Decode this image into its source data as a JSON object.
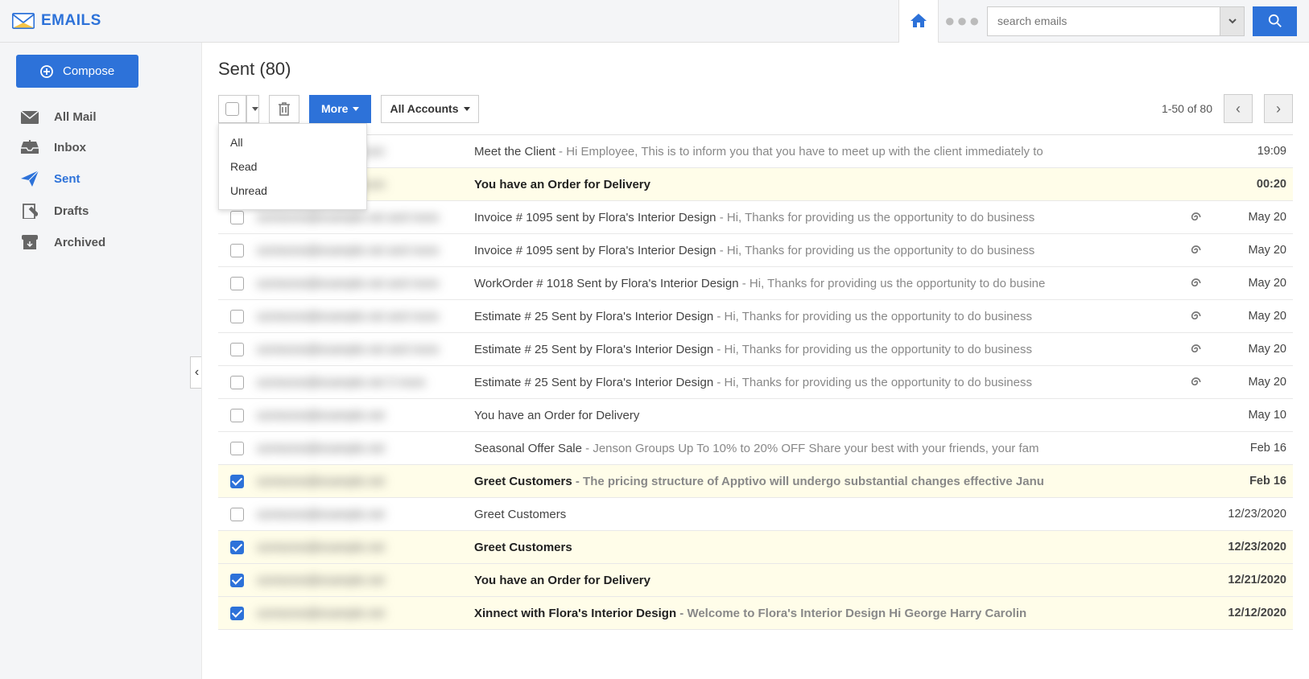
{
  "header": {
    "logo_text": "EMAILS",
    "search_placeholder": "search emails"
  },
  "sidebar": {
    "compose_label": "Compose",
    "items": [
      {
        "label": "All Mail"
      },
      {
        "label": "Inbox"
      },
      {
        "label": "Sent"
      },
      {
        "label": "Drafts"
      },
      {
        "label": "Archived"
      }
    ]
  },
  "main": {
    "title": "Sent (80)",
    "more_label": "More",
    "accounts_label": "All Accounts",
    "pager_label": "1-50 of 80",
    "dropdown": [
      "All",
      "Read",
      "Unread"
    ]
  },
  "emails": [
    {
      "checked": false,
      "unread": false,
      "sender": "noreply@outerijam.com",
      "subject": "Meet the Client",
      "preview": " - Hi Employee, This is to inform you that you have to meet up with the client immediately to",
      "attach": false,
      "date": "19:09"
    },
    {
      "checked": false,
      "unread": true,
      "sender": "support@outerijam.com",
      "subject": "You have an Order for Delivery",
      "preview": "",
      "attach": false,
      "date": "00:20"
    },
    {
      "checked": false,
      "unread": false,
      "sender": "someone@example.net and more",
      "subject": "Invoice # 1095 sent by Flora's Interior Design",
      "preview": " - Hi,  Thanks for providing us the opportunity to do business",
      "attach": true,
      "date": "May 20"
    },
    {
      "checked": false,
      "unread": false,
      "sender": "someone@example.net and more",
      "subject": "Invoice # 1095 sent by Flora's Interior Design",
      "preview": " - Hi,  Thanks for providing us the opportunity to do business",
      "attach": true,
      "date": "May 20"
    },
    {
      "checked": false,
      "unread": false,
      "sender": "someone@example.net and more",
      "subject": "WorkOrder # 1018 Sent by Flora's Interior Design",
      "preview": " - Hi, Thanks for providing us the opportunity to do busine",
      "attach": true,
      "date": "May 20"
    },
    {
      "checked": false,
      "unread": false,
      "sender": "someone@example.net and more",
      "subject": "Estimate # 25 Sent by Flora's Interior Design",
      "preview": " - Hi,  Thanks for providing us the opportunity to do business ",
      "attach": true,
      "date": "May 20"
    },
    {
      "checked": false,
      "unread": false,
      "sender": "someone@example.net and more",
      "subject": "Estimate # 25 Sent by Flora's Interior Design",
      "preview": " - Hi,  Thanks for providing us the opportunity to do business ",
      "attach": true,
      "date": "May 20"
    },
    {
      "checked": false,
      "unread": false,
      "sender": "someone@example.net 3 more",
      "subject": "Estimate # 25 Sent by Flora's Interior Design",
      "preview": " - Hi,  Thanks for providing us the opportunity to do business ",
      "attach": true,
      "date": "May 20"
    },
    {
      "checked": false,
      "unread": false,
      "sender": "someone@example.net",
      "subject": "You have an Order for Delivery",
      "preview": "",
      "attach": false,
      "date": "May 10"
    },
    {
      "checked": false,
      "unread": false,
      "sender": "someone@example.net",
      "subject": "Seasonal Offer Sale",
      "preview": " - Jenson Groups Up To 10% to 20% OFF Share your best with your friends, your fam",
      "attach": false,
      "date": "Feb 16"
    },
    {
      "checked": true,
      "unread": true,
      "sender": "someone@example.net",
      "subject": "Greet Customers ",
      "preview": " - The pricing structure of Apptivo will undergo substantial changes effective Janu",
      "attach": false,
      "date": "Feb 16"
    },
    {
      "checked": false,
      "unread": false,
      "sender": "someone@example.net",
      "subject": "Greet Customers",
      "preview": "",
      "attach": false,
      "date": "12/23/2020"
    },
    {
      "checked": true,
      "unread": true,
      "sender": "someone@example.net",
      "subject": "Greet Customers",
      "preview": "",
      "attach": false,
      "date": "12/23/2020"
    },
    {
      "checked": true,
      "unread": true,
      "sender": "someone@example.net",
      "subject": "You have an Order for Delivery",
      "preview": "",
      "attach": false,
      "date": "12/21/2020"
    },
    {
      "checked": true,
      "unread": true,
      "sender": "someone@example.net",
      "subject": "Xinnect with Flora's Interior Design ",
      "preview": " -  Welcome to Flora's Interior Design   Hi George Harry Carolin",
      "attach": false,
      "date": "12/12/2020"
    }
  ]
}
